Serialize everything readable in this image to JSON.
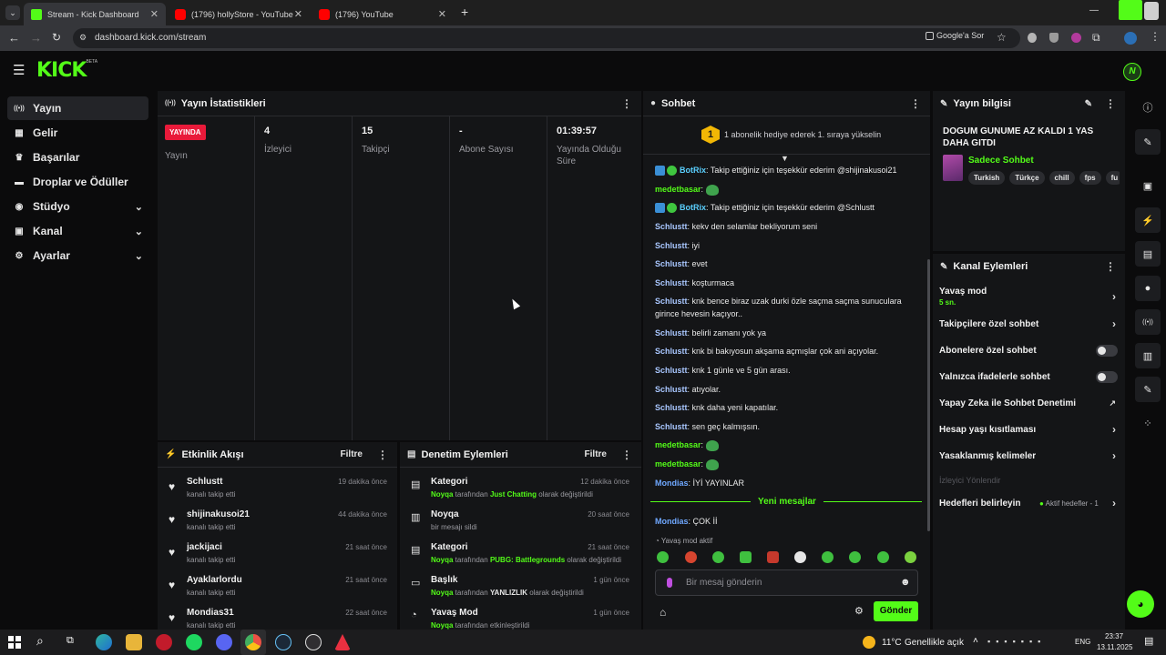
{
  "browser": {
    "tabs": [
      {
        "label": "Stream - Kick Dashboard",
        "active": true
      },
      {
        "label": "(1796) hollyStore - YouTube",
        "active": false
      },
      {
        "label": "(1796) YouTube",
        "active": false
      }
    ],
    "new_tab": "+",
    "url": "dashboard.kick.com/stream",
    "google_sor": "Google'a Sor",
    "window_controls": {
      "minimize": "—",
      "close": "✕"
    }
  },
  "header": {
    "logo": "KICK",
    "logo_sup": "BETA",
    "avatar_letter": "N"
  },
  "sidebar": {
    "items": [
      {
        "label": "Yayın",
        "icon": "broadcast-icon",
        "glyph": "((•))",
        "active": true,
        "expand": false
      },
      {
        "label": "Gelir",
        "icon": "revenue-icon",
        "glyph": "▦",
        "active": false,
        "expand": false
      },
      {
        "label": "Başarılar",
        "icon": "trophy-icon",
        "glyph": "🏆",
        "active": false,
        "expand": false
      },
      {
        "label": "Droplar ve Ödüller",
        "icon": "drops-icon",
        "glyph": "▬",
        "active": false,
        "expand": false
      },
      {
        "label": "Stüdyo",
        "icon": "studio-icon",
        "glyph": "◉",
        "active": false,
        "expand": true
      },
      {
        "label": "Kanal",
        "icon": "channel-icon",
        "glyph": "▣",
        "active": false,
        "expand": true
      },
      {
        "label": "Ayarlar",
        "icon": "settings-icon",
        "glyph": "⚙",
        "active": false,
        "expand": true
      }
    ]
  },
  "stats": {
    "title": "Yayın İstatistikleri",
    "live_badge": "YAYINDA",
    "cols": [
      {
        "value": "",
        "label": "Yayın"
      },
      {
        "value": "4",
        "label": "İzleyici"
      },
      {
        "value": "15",
        "label": "Takipçi"
      },
      {
        "value": "-",
        "label": "Abone Sayısı"
      },
      {
        "value": "01:39:57",
        "label": "Yayında Olduğu Süre"
      }
    ]
  },
  "activity": {
    "title": "Etkinlik Akışı",
    "filter": "Filtre",
    "rows": [
      {
        "name": "Schlustt",
        "sub": "kanalı takip etti",
        "time": "19 dakika önce"
      },
      {
        "name": "shijinakusoi21",
        "sub": "kanalı takip etti",
        "time": "44 dakika önce"
      },
      {
        "name": "jackijaci",
        "sub": "kanalı takip etti",
        "time": "21 saat önce"
      },
      {
        "name": "Ayaklarlordu",
        "sub": "kanalı takip etti",
        "time": "21 saat önce"
      },
      {
        "name": "Mondias31",
        "sub": "kanalı takip etti",
        "time": "22 saat önce"
      }
    ]
  },
  "moderation": {
    "title": "Denetim Eylemleri",
    "filter": "Filtre",
    "rows": [
      {
        "name": "Kategori",
        "icon": "category-icon",
        "glyph": "▤",
        "time": "12 dakika önce",
        "actor": "Noyqa",
        "mid": " tarafından ",
        "value": "Just Chatting",
        "tail": " olarak değiştirildi"
      },
      {
        "name": "Noyqa",
        "icon": "trash-icon",
        "glyph": "🗑",
        "time": "20 saat önce",
        "actor": "",
        "mid": "bir mesajı sildi",
        "value": "",
        "tail": ""
      },
      {
        "name": "Kategori",
        "icon": "category-icon",
        "glyph": "▤",
        "time": "21 saat önce",
        "actor": "Noyqa",
        "mid": " tarafından ",
        "value": "PUBG: Battlegrounds",
        "tail": " olarak değiştirildi"
      },
      {
        "name": "Başlık",
        "icon": "title-icon",
        "glyph": "▭",
        "time": "1 gün önce",
        "actor": "Noyqa",
        "mid": " tarafından ",
        "value": "YANLIZLIK",
        "tail": " olarak değiştirildi"
      },
      {
        "name": "Yavaş Mod",
        "icon": "slow-mode-icon",
        "glyph": "🐌",
        "time": "1 gün önce",
        "actor": "Noyqa",
        "mid": " tarafından etkinleştirildi",
        "value": "",
        "tail": ""
      }
    ]
  },
  "chat": {
    "title": "Sohbet",
    "goal_rank": "1",
    "goal_text": "1 abonelik hediye ederek 1. sıraya yükselin",
    "messages": [
      {
        "user": "BotRix",
        "type": "bot",
        "text": ": Takip ettiğiniz için teşekkür ederim @shijinakusoi21",
        "emote": false
      },
      {
        "user": "medetbasar",
        "type": "green",
        "text": ":",
        "emote": true
      },
      {
        "user": "BotRix",
        "type": "bot",
        "text": ": Takip ettiğiniz için teşekkür ederim @Schlustt",
        "emote": false
      },
      {
        "user": "Schlustt",
        "type": "user",
        "text": ": kekv den selamlar bekliyorum seni",
        "emote": false
      },
      {
        "user": "Schlustt",
        "type": "user",
        "text": ": iyi",
        "emote": false
      },
      {
        "user": "Schlustt",
        "type": "user",
        "text": ": evet",
        "emote": false
      },
      {
        "user": "Schlustt",
        "type": "user",
        "text": ": koşturmaca",
        "emote": false
      },
      {
        "user": "Schlustt",
        "type": "user",
        "text": ": knk bence biraz uzak durki özle saçma saçma sunuculara girince hevesin kaçıyor..",
        "emote": false
      },
      {
        "user": "Schlustt",
        "type": "user",
        "text": ": belirli zamanı yok ya",
        "emote": false
      },
      {
        "user": "Schlustt",
        "type": "user",
        "text": ": knk bi bakıyosun akşama açmışlar çok ani açıyolar.",
        "emote": false
      },
      {
        "user": "Schlustt",
        "type": "user",
        "text": ": knk 1 günle ve 5 gün arası.",
        "emote": false
      },
      {
        "user": "Schlustt",
        "type": "user",
        "text": ": atıyolar.",
        "emote": false
      },
      {
        "user": "Schlustt",
        "type": "user",
        "text": ": knk daha yeni kapatılar.",
        "emote": false
      },
      {
        "user": "Schlustt",
        "type": "user",
        "text": ": sen geç kalmışsın.",
        "emote": false
      },
      {
        "user": "medetbasar",
        "type": "green",
        "text": ":",
        "emote": true
      },
      {
        "user": "medetbasar",
        "type": "green",
        "text": ":",
        "emote": true
      },
      {
        "user": "Mondias",
        "type": "blue",
        "text": ": İYİ YAYINLAR",
        "emote": false
      }
    ],
    "new_messages": "Yeni mesajlar",
    "after_divider": {
      "user": "Mondias",
      "text": ": ÇOK İİ"
    },
    "slow_mode": "Yavaş mod aktif",
    "input_placeholder": "Bir mesaj gönderin",
    "send": "Gönder"
  },
  "stream_info": {
    "title": "Yayın bilgisi",
    "stream_title": "DOGUM GUNUME AZ KALDI 1 YAS DAHA GITDI",
    "category": "Sadece Sohbet",
    "tags": [
      "Turkish",
      "Türkçe",
      "chill",
      "fps",
      "fu"
    ]
  },
  "channel_actions": {
    "title": "Kanal Eylemleri",
    "items": [
      {
        "label": "Yavaş mod",
        "sub": "5 sn.",
        "control": "arrow"
      },
      {
        "label": "Takipçilere özel sohbet",
        "sub": "",
        "control": "arrow"
      },
      {
        "label": "Abonelere özel sohbet",
        "sub": "",
        "control": "toggle"
      },
      {
        "label": "Yalnızca ifadelerle sohbet",
        "sub": "",
        "control": "toggle"
      },
      {
        "label": "Yapay Zeka ile Sohbet Denetimi",
        "sub": "",
        "control": "external"
      },
      {
        "label": "Hesap yaşı kısıtlaması",
        "sub": "",
        "control": "arrow"
      },
      {
        "label": "Yasaklanmış kelimeler",
        "sub": "",
        "control": "arrow"
      },
      {
        "label": "İzleyici Yönlendir",
        "sub": "",
        "control": "disabled"
      },
      {
        "label": "Hedefleri belirleyin",
        "sub": "Aktif hedefler - 1",
        "control": "arrow"
      }
    ]
  },
  "taskbar": {
    "weather": "11°C",
    "weather_text": "Genellikle açık",
    "lang": "ENG",
    "time": "23:37",
    "date": "13.11.2025"
  },
  "colors": {
    "accent": "#53fc18",
    "live": "#e91a3a",
    "panel": "#141517",
    "bg": "#0b0b0c"
  }
}
